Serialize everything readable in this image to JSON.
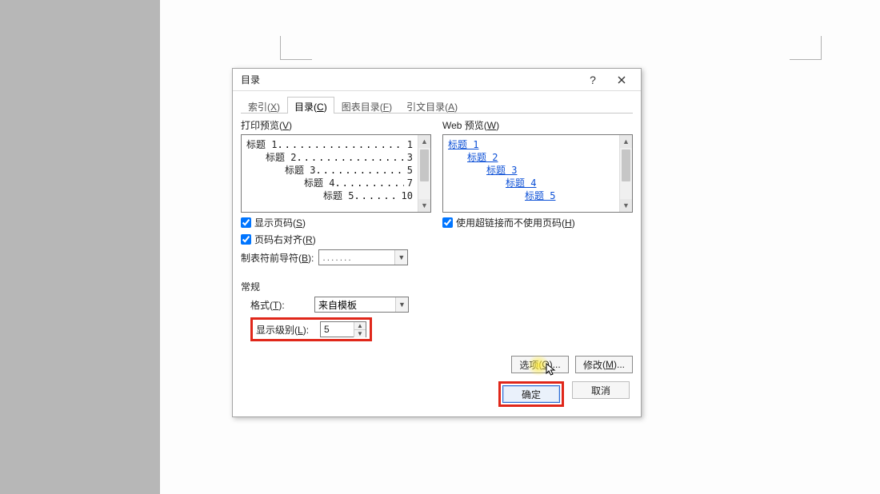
{
  "dialog": {
    "title": "目录",
    "help_symbol": "?",
    "tabs": [
      {
        "label": "索引",
        "accel": "X"
      },
      {
        "label": "目录",
        "accel": "C"
      },
      {
        "label": "图表目录",
        "accel": "F"
      },
      {
        "label": "引文目录",
        "accel": "A"
      }
    ],
    "active_tab_index": 1,
    "print_preview": {
      "label": "打印预览",
      "accel": "V",
      "lines": [
        {
          "title": "标题 1",
          "indent_ch": 0,
          "page": "1"
        },
        {
          "title": "标题 2",
          "indent_ch": 2,
          "page": "3"
        },
        {
          "title": "标题 3",
          "indent_ch": 4,
          "page": "5"
        },
        {
          "title": "标题 4",
          "indent_ch": 6,
          "page": "7"
        },
        {
          "title": "标题 5",
          "indent_ch": 8,
          "page": "10"
        }
      ]
    },
    "web_preview": {
      "label": "Web 预览",
      "accel": "W",
      "lines": [
        {
          "title": "标题 1",
          "indent_ch": 0
        },
        {
          "title": "标题 2",
          "indent_ch": 2
        },
        {
          "title": "标题 3",
          "indent_ch": 4
        },
        {
          "title": "标题 4",
          "indent_ch": 6
        },
        {
          "title": "标题 5",
          "indent_ch": 8
        }
      ]
    },
    "show_page_numbers": {
      "label": "显示页码",
      "accel": "S",
      "checked": true
    },
    "right_align_page_numbers": {
      "label": "页码右对齐",
      "accel": "R",
      "checked": true
    },
    "tab_leader": {
      "label": "制表符前导符",
      "accel": "B",
      "value": "......."
    },
    "use_hyperlinks": {
      "label": "使用超链接而不使用页码",
      "accel": "H",
      "checked": true
    },
    "general_title": "常规",
    "format": {
      "label": "格式",
      "accel": "T",
      "value": "来自模板"
    },
    "show_levels": {
      "label": "显示级别",
      "accel": "L",
      "value": "5"
    },
    "buttons": {
      "options": {
        "label": "选项",
        "accel": "O",
        "suffix": "..."
      },
      "modify": {
        "label": "修改",
        "accel": "M",
        "suffix": "..."
      },
      "ok": "确定",
      "cancel": "取消"
    }
  }
}
